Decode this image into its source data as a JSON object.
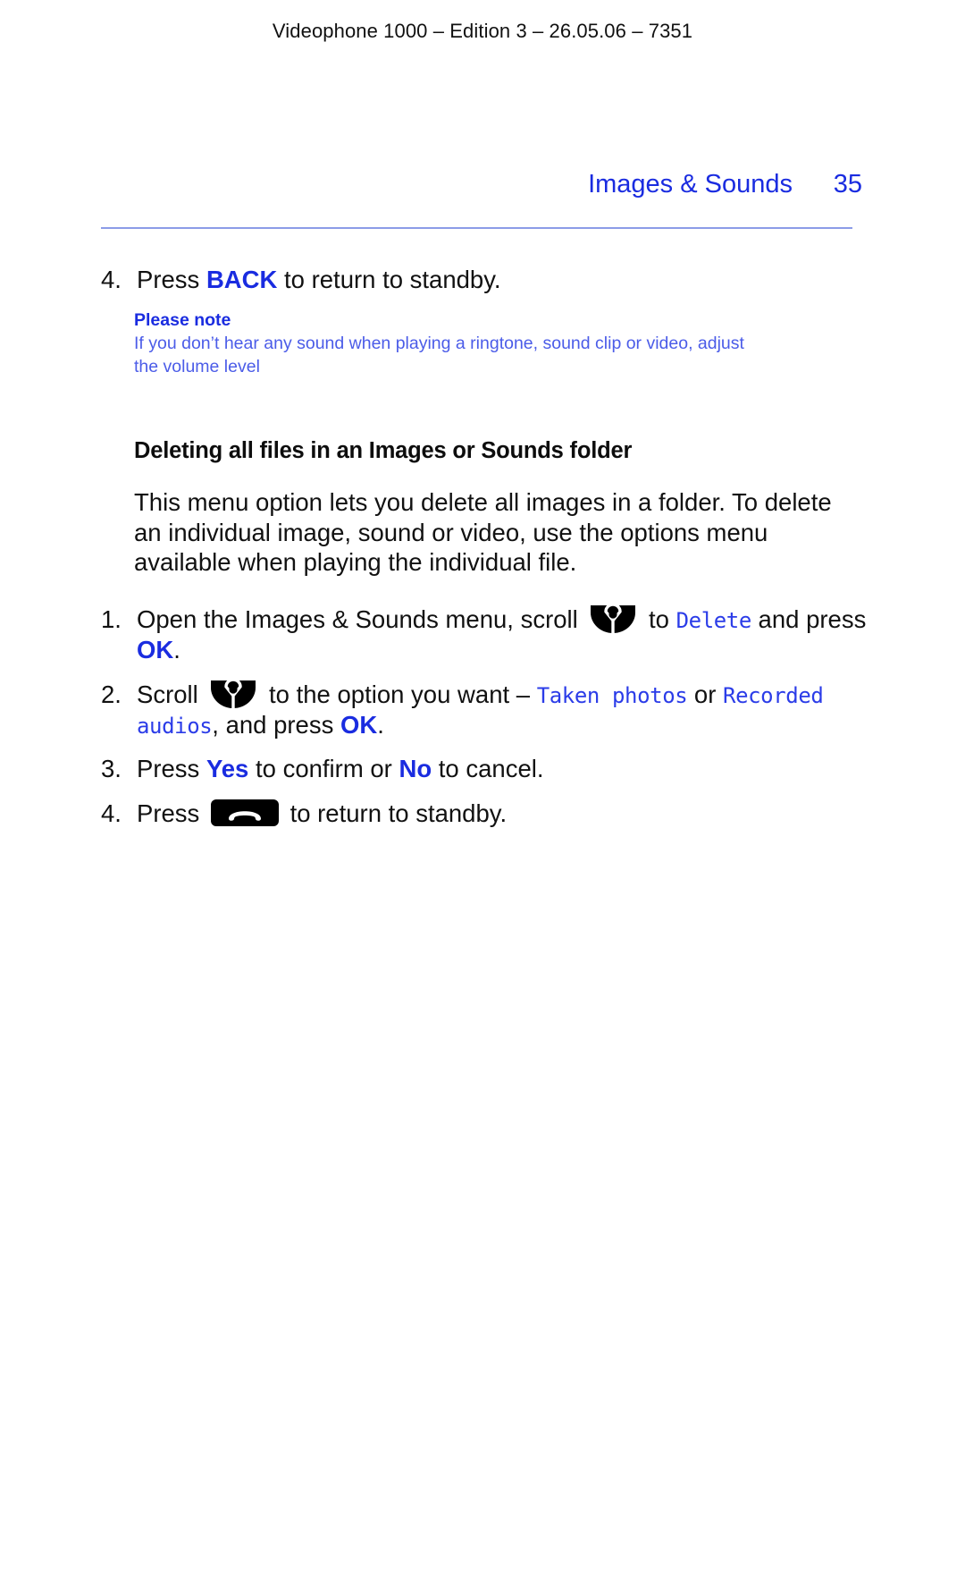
{
  "document": {
    "running_header": "Videophone 1000 – Edition 3 – 26.05.06 – 7351",
    "chapter_title": "Images & Sounds",
    "page_number": "35",
    "accent_color": "#1a2ce0",
    "rule_color": "#8c9ce8",
    "lcd_color": "#2b3ce8",
    "note_color": "#4b5ce8"
  },
  "top_step": {
    "number": "4.",
    "text_before": "Press ",
    "keyword": "BACK",
    "text_after": " to return to standby."
  },
  "note": {
    "title": "Please note",
    "line1": "If you don’t hear any sound when playing a ringtone, sound clip or video, adjust",
    "line2": "the volume level"
  },
  "section": {
    "heading": "Deleting all files in an Images or Sounds folder",
    "intro": "This menu option lets you delete all images in a folder. To delete an individual image, sound or video, use the options menu available when playing the individual file."
  },
  "steps": [
    {
      "number": "1.",
      "seg1": "Open the Images & Sounds menu, scroll ",
      "icon": "navigation-key-icon",
      "seg2": " to ",
      "lcd1": "Delete",
      "seg3": " and press ",
      "keyword": "OK",
      "seg4": "."
    },
    {
      "number": "2.",
      "seg1": "Scroll ",
      "icon": "navigation-key-icon",
      "seg2": " to the option you want – ",
      "lcd1": "Taken photos",
      "seg3": " or ",
      "lcd2": "Recorded audios",
      "seg4": ", and press ",
      "keyword": "OK",
      "seg5": "."
    },
    {
      "number": "3.",
      "seg1": "Press ",
      "keyword1": "Yes",
      "seg2": " to confirm or ",
      "keyword2": "No",
      "seg3": " to cancel."
    },
    {
      "number": "4.",
      "seg1": "Press ",
      "icon": "hangup-key-icon",
      "seg2": " to return to standby."
    }
  ]
}
